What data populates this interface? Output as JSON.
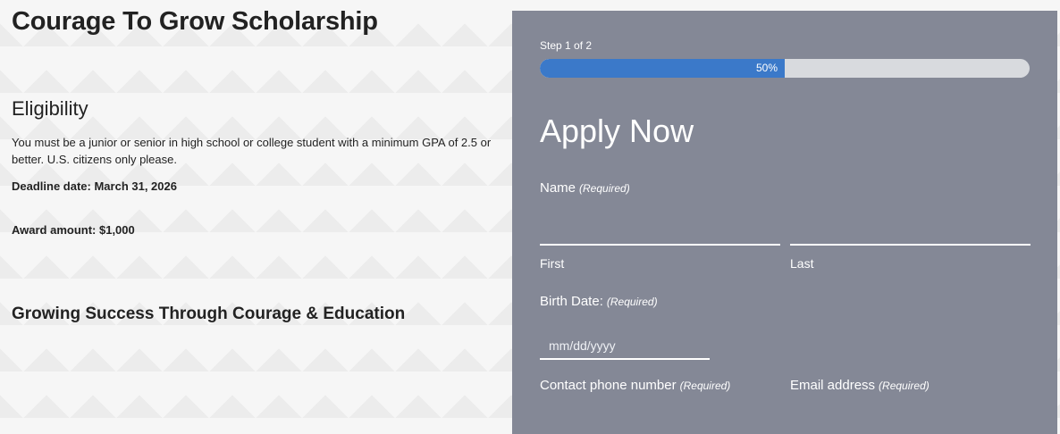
{
  "page": {
    "title": "Courage To Grow Scholarship",
    "eligibility_heading": "Eligibility",
    "eligibility_text": "You must be a junior or senior in high school or college student with a minimum GPA of 2.5 or better. U.S. citizens only please.",
    "deadline": "Deadline date: March 31, 2026",
    "award": "Award amount: $1,000",
    "tagline": "Growing Success Through Courage & Education"
  },
  "form": {
    "step_text": "Step 1 of 2",
    "progress": {
      "value": 0.5,
      "label": "50%"
    },
    "heading": "Apply Now",
    "required_tag": "(Required)",
    "name": {
      "label": "Name",
      "first_value": "",
      "last_value": "",
      "first_sublabel": "First",
      "last_sublabel": "Last"
    },
    "birth_date": {
      "label": "Birth Date:",
      "value": "",
      "placeholder": "mm/dd/yyyy"
    },
    "phone": {
      "label": "Contact phone number"
    },
    "email": {
      "label": "Email address"
    }
  },
  "colors": {
    "panel": "#848896",
    "progress_fill": "#3b79c9",
    "progress_track": "#d8dade"
  }
}
